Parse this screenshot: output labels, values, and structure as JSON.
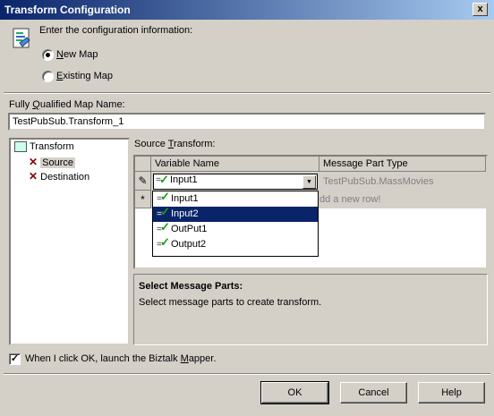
{
  "window": {
    "title": "Transform Configuration",
    "close_glyph": "x"
  },
  "intro": {
    "text": "Enter the configuration information:"
  },
  "map_type": {
    "new_map": {
      "label": "New Map",
      "selected": true
    },
    "existing_map": {
      "label": "Existing Map",
      "selected": false
    }
  },
  "map_name": {
    "label": "Fully Qualified Map Name:",
    "value": "TestPubSub.Transform_1"
  },
  "tree": {
    "root": "Transform",
    "items": [
      {
        "label": "Source",
        "selected": true
      },
      {
        "label": "Destination",
        "selected": false
      }
    ]
  },
  "source_transform": {
    "label": "Source Transform:",
    "columns": [
      "Variable Name",
      "Message Part Type"
    ],
    "rows": [
      {
        "row_marker": "✎",
        "variable": "Input1",
        "type": "TestPubSub.MassMovies"
      },
      {
        "row_marker": "*",
        "variable": "",
        "type": "dd a new row!"
      }
    ],
    "dropdown_options": [
      "Input1",
      "Input2",
      "OutPut1",
      "Output2"
    ],
    "dropdown_selected_index": 1
  },
  "help_panel": {
    "title": "Select Message Parts:",
    "text": "Select message parts to create transform."
  },
  "launch_mapper": {
    "label": "When I click OK, launch the Biztalk Mapper.",
    "checked": true
  },
  "buttons": {
    "ok": "OK",
    "cancel": "Cancel",
    "help": "Help"
  },
  "colors": {
    "titlebar_start": "#0a246a",
    "titlebar_end": "#a6caf0",
    "selection": "#0a246a"
  }
}
